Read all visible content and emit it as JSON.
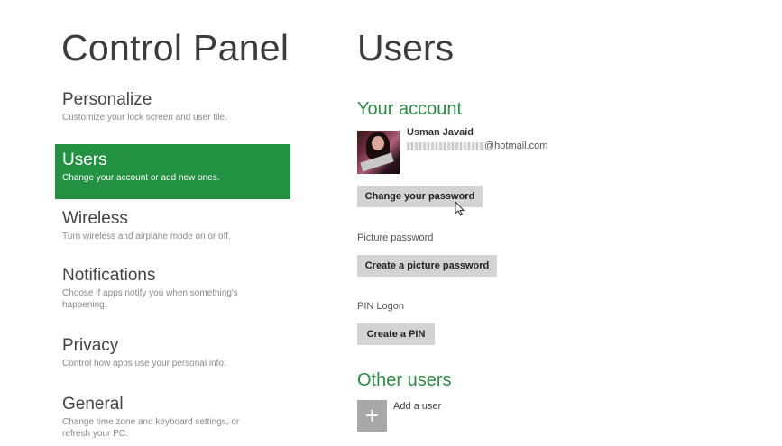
{
  "left_title": "Control Panel",
  "right_title": "Users",
  "nav": [
    {
      "title": "Personalize",
      "desc": "Customize your lock screen and user tile."
    },
    {
      "title": "Users",
      "desc": "Change your account or add new ones."
    },
    {
      "title": "Wireless",
      "desc": "Turn wireless and airplane mode on or off."
    },
    {
      "title": "Notifications",
      "desc": "Choose if apps notify you when something's happening."
    },
    {
      "title": "Privacy",
      "desc": "Control how apps use your personal info."
    },
    {
      "title": "General",
      "desc": "Change time zone and keyboard settings, or refresh your PC."
    }
  ],
  "account": {
    "heading": "Your account",
    "name": "Usman Javaid",
    "email_suffix": "@hotmail.com",
    "change_password_label": "Change your password",
    "picture_password_label": "Picture password",
    "create_picture_password_label": "Create a picture password",
    "pin_label": "PIN Logon",
    "create_pin_label": "Create a PIN"
  },
  "other_users": {
    "heading": "Other users",
    "add_icon": "+",
    "add_label": "Add a user"
  },
  "colors": {
    "accent": "#229142",
    "heading_green": "#2e8b45"
  }
}
